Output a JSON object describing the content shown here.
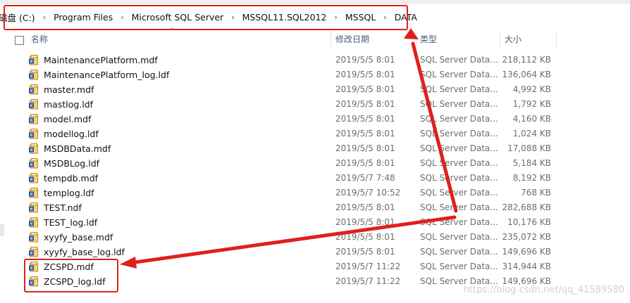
{
  "breadcrumb": [
    "磁盘 (C:)",
    "Program Files",
    "Microsoft SQL Server",
    "MSSQL11.SQL2012",
    "MSSQL",
    "DATA"
  ],
  "columns": {
    "name": "名称",
    "date": "修改日期",
    "type": "类型",
    "size": "大小"
  },
  "files": [
    {
      "name": "MaintenancePlatform.mdf",
      "date": "2019/5/5 8:01",
      "type": "SQL Server Data...",
      "size": "218,112 KB"
    },
    {
      "name": "MaintenancePlatform_log.ldf",
      "date": "2019/5/5 8:01",
      "type": "SQL Server Data...",
      "size": "136,064 KB"
    },
    {
      "name": "master.mdf",
      "date": "2019/5/5 8:01",
      "type": "SQL Server Data...",
      "size": "4,992 KB"
    },
    {
      "name": "mastlog.ldf",
      "date": "2019/5/5 8:01",
      "type": "SQL Server Data...",
      "size": "1,792 KB"
    },
    {
      "name": "model.mdf",
      "date": "2019/5/5 8:01",
      "type": "SQL Server Data...",
      "size": "4,160 KB"
    },
    {
      "name": "modellog.ldf",
      "date": "2019/5/5 8:01",
      "type": "SQL Server Data...",
      "size": "1,024 KB"
    },
    {
      "name": "MSDBData.mdf",
      "date": "2019/5/5 8:01",
      "type": "SQL Server Data...",
      "size": "17,088 KB"
    },
    {
      "name": "MSDBLog.ldf",
      "date": "2019/5/5 8:01",
      "type": "SQL Server Data...",
      "size": "5,184 KB"
    },
    {
      "name": "tempdb.mdf",
      "date": "2019/5/7 7:48",
      "type": "SQL Server Data...",
      "size": "8,192 KB"
    },
    {
      "name": "templog.ldf",
      "date": "2019/5/7 10:52",
      "type": "SQL Server Data...",
      "size": "768 KB"
    },
    {
      "name": "TEST.ndf",
      "date": "2019/5/5 8:01",
      "type": "SQL Server Data...",
      "size": "282,688 KB"
    },
    {
      "name": "TEST_log.ldf",
      "date": "2019/5/5 8:01",
      "type": "SQL Server Data...",
      "size": "10,176 KB"
    },
    {
      "name": "xyyfy_base.mdf",
      "date": "2019/5/5 8:01",
      "type": "SQL Server Data...",
      "size": "235,072 KB"
    },
    {
      "name": "xyyfy_base_log.ldf",
      "date": "2019/5/5 8:01",
      "type": "SQL Server Data...",
      "size": "149,696 KB"
    },
    {
      "name": "ZCSPD.mdf",
      "date": "2019/5/7 11:22",
      "type": "SQL Server Data...",
      "size": "314,944 KB"
    },
    {
      "name": "ZCSPD_log.ldf",
      "date": "2019/5/7 11:22",
      "type": "SQL Server Data...",
      "size": "149,696 KB"
    }
  ],
  "watermark": "https://blog.csdn.net/qq_41589580",
  "annotation_color": "#e0201c",
  "icons": {
    "file": "sql-data-file-icon",
    "sort": "sort-up-icon"
  }
}
